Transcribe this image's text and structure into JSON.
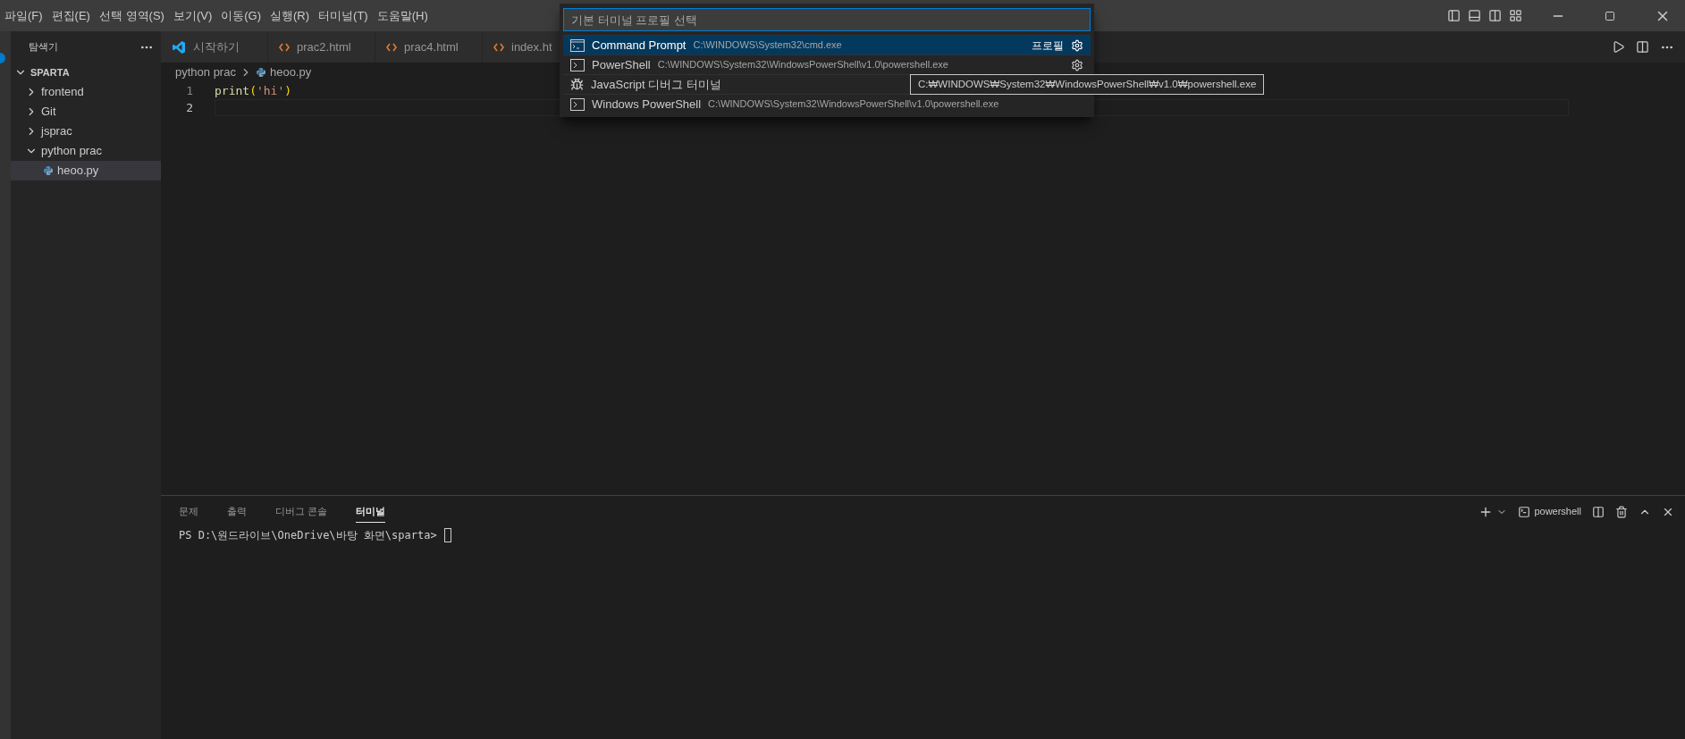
{
  "menu": [
    "파일(F)",
    "편집(E)",
    "선택 영역(S)",
    "보기(V)",
    "이동(G)",
    "실행(R)",
    "터미널(T)",
    "도움말(H)"
  ],
  "sidebar": {
    "title": "탐색기",
    "tree": [
      {
        "label": "SPARTA",
        "kind": "root",
        "expanded": true,
        "selected": false,
        "children": [
          {
            "label": "frontend",
            "expanded": false,
            "selected": false
          },
          {
            "label": "Git",
            "expanded": false,
            "selected": false
          },
          {
            "label": "jsprac",
            "expanded": false,
            "selected": false
          },
          {
            "label": "python prac",
            "expanded": true,
            "selected": false,
            "children": [
              {
                "label": "heoo.py",
                "kind": "python",
                "selected": true
              }
            ]
          }
        ]
      }
    ]
  },
  "tabs": [
    {
      "label": "시작하기",
      "kind": "vscode"
    },
    {
      "label": "prac2.html",
      "kind": "html"
    },
    {
      "label": "prac4.html",
      "kind": "html"
    },
    {
      "label": "index.ht",
      "kind": "html"
    }
  ],
  "breadcrumb": [
    {
      "label": "python prac"
    },
    {
      "label": "heoo.py",
      "kind": "python"
    }
  ],
  "editor": {
    "lines": [
      {
        "number": "1",
        "current": false,
        "tokens": [
          {
            "text": "print",
            "kind": "function"
          },
          {
            "text": "(",
            "kind": "bracket"
          },
          {
            "text": "'hi'",
            "kind": "string"
          },
          {
            "text": ")",
            "kind": "bracket"
          }
        ]
      },
      {
        "number": "2",
        "current": true
      }
    ]
  },
  "quick_pick": {
    "placeholder": "기본 터미널 프로필 선택",
    "items": [
      {
        "label": "Command Prompt",
        "detail": "C:\\WINDOWS\\System32\\cmd.exe",
        "kind": "cmd",
        "badge": "프로필",
        "gear": true,
        "selected": true
      },
      {
        "label": "PowerShell",
        "detail": "C:\\WINDOWS\\System32\\WindowsPowerShell\\v1.0\\powershell.exe",
        "kind": "shell",
        "gear": true,
        "selected": false
      },
      {
        "label": "JavaScript 디버그 터미널",
        "kind": "debug",
        "gear": false,
        "selected": false
      },
      {
        "label": "Windows PowerShell",
        "detail": "C:\\WINDOWS\\System32\\WindowsPowerShell\\v1.0\\powershell.exe",
        "kind": "shell",
        "gear": false,
        "selected": false
      }
    ]
  },
  "tooltip": "C:₩WINDOWS₩System32₩WindowsPowerShell₩v1.0₩powershell.exe",
  "panel": {
    "tabs": [
      {
        "label": "문제",
        "selected": false
      },
      {
        "label": "출력",
        "selected": false
      },
      {
        "label": "디버그 콘솔",
        "selected": false
      },
      {
        "label": "터미널",
        "selected": true
      }
    ],
    "terminal_name": "powershell",
    "prompt": "PS D:\\원드라이브\\OneDrive\\바탕 화면\\sparta>"
  }
}
